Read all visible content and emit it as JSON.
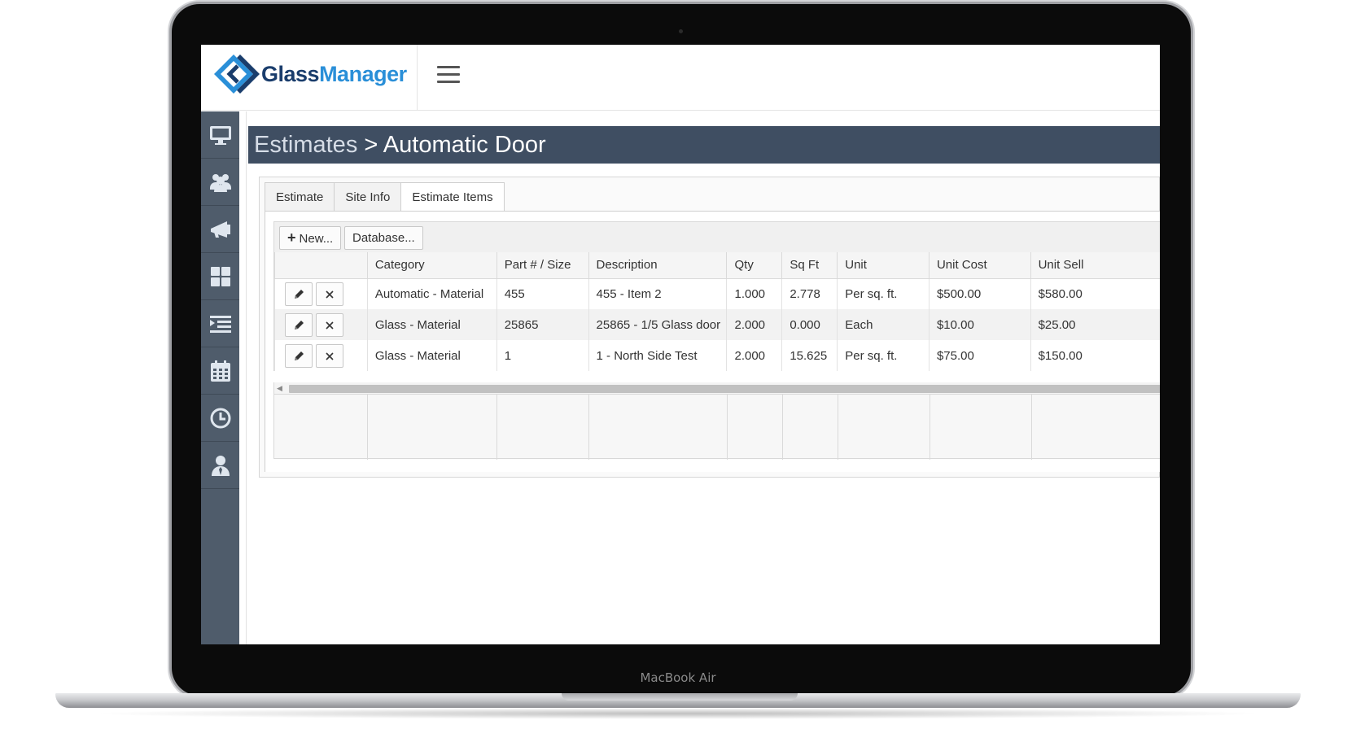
{
  "device": {
    "label": "MacBook Air"
  },
  "app": {
    "logo": {
      "part1": "Glass",
      "part2": "Manager"
    },
    "breadcrumb": {
      "parent": "Estimates",
      "separator": ">",
      "current": "Automatic Door"
    }
  },
  "sidebar": {
    "items": [
      {
        "icon": "monitor-icon"
      },
      {
        "icon": "users-icon"
      },
      {
        "icon": "megaphone-icon"
      },
      {
        "icon": "grid-icon"
      },
      {
        "icon": "list-icon"
      },
      {
        "icon": "calendar-icon"
      },
      {
        "icon": "clock-icon"
      },
      {
        "icon": "user-tie-icon"
      }
    ]
  },
  "tabs": [
    {
      "label": "Estimate"
    },
    {
      "label": "Site Info"
    },
    {
      "label": "Estimate Items",
      "active": true
    }
  ],
  "toolbar": {
    "new_label": "New...",
    "database_label": "Database..."
  },
  "table": {
    "columns": [
      "",
      "Category",
      "Part # / Size",
      "Description",
      "Qty",
      "Sq Ft",
      "Unit",
      "Unit Cost",
      "Unit Sell"
    ],
    "rows": [
      {
        "category": "Automatic - Material",
        "part": "455",
        "description": "455 - Item 2",
        "qty": "1.000",
        "sqft": "2.778",
        "unit": "Per sq. ft.",
        "unit_cost": "$500.00",
        "unit_sell": "$580.00"
      },
      {
        "category": "Glass - Material",
        "part": "25865",
        "description": "25865 - 1/5 Glass door",
        "qty": "2.000",
        "sqft": "0.000",
        "unit": "Each",
        "unit_cost": "$10.00",
        "unit_sell": "$25.00"
      },
      {
        "category": "Glass - Material",
        "part": "1",
        "description": "1 - North Side Test",
        "qty": "2.000",
        "sqft": "15.625",
        "unit": "Per sq. ft.",
        "unit_cost": "$75.00",
        "unit_sell": "$150.00"
      }
    ]
  },
  "colors": {
    "header_bg": "#3f4e62",
    "sidebar_bg": "#4f5c6b",
    "logo_dark": "#1a3d6c",
    "logo_light": "#2a8fd8"
  }
}
